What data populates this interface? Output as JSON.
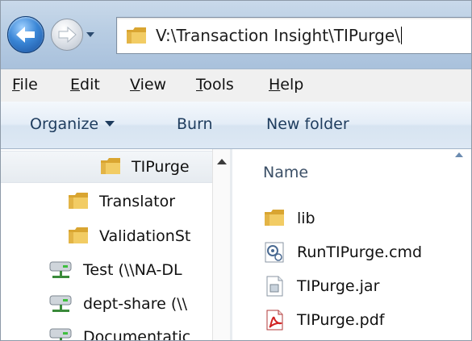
{
  "address": {
    "path": "V:\\Transaction Insight\\TIPurge\\"
  },
  "menu": [
    {
      "underline": "F",
      "rest": "ile"
    },
    {
      "underline": "E",
      "rest": "dit"
    },
    {
      "underline": "V",
      "rest": "iew"
    },
    {
      "underline": "T",
      "rest": "ools"
    },
    {
      "underline": "H",
      "rest": "elp"
    }
  ],
  "toolbar": {
    "organize": "Organize",
    "burn": "Burn",
    "new_folder": "New folder"
  },
  "nav_tree": [
    {
      "label": "TIPurge",
      "icon": "folder-icon"
    },
    {
      "label": "Translator",
      "icon": "folder-icon"
    },
    {
      "label": "ValidationSt",
      "icon": "folder-icon"
    },
    {
      "label": "Test (\\\\NA-DL",
      "icon": "network-drive-icon"
    },
    {
      "label": "dept-share (\\\\",
      "icon": "network-drive-icon"
    },
    {
      "label": "Documentatic",
      "icon": "network-drive-icon"
    }
  ],
  "file_list": {
    "column_name": "Name",
    "items": [
      {
        "label": "lib",
        "icon": "folder-icon"
      },
      {
        "label": "RunTIPurge.cmd",
        "icon": "cmd-file-icon"
      },
      {
        "label": "TIPurge.jar",
        "icon": "jar-file-icon"
      },
      {
        "label": "TIPurge.pdf",
        "icon": "pdf-file-icon"
      }
    ]
  },
  "colors": {
    "accent": "#1e3c5e",
    "folder": "#e8b84a"
  }
}
